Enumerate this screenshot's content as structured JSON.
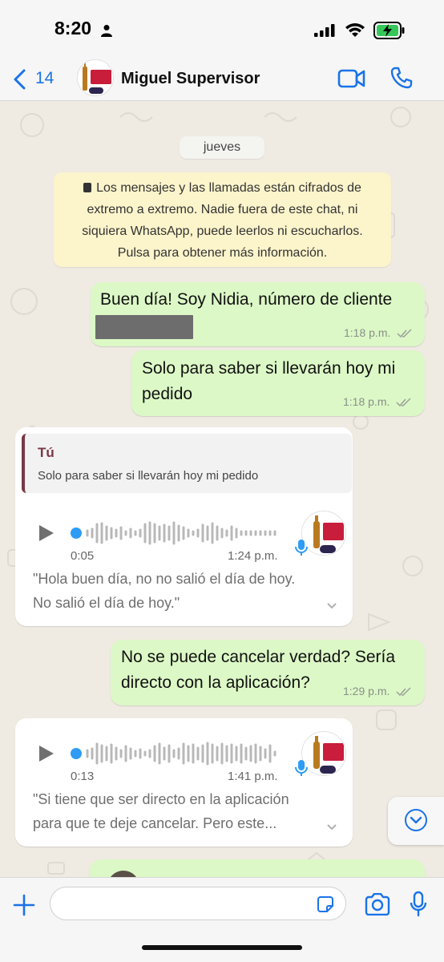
{
  "status_bar": {
    "time": "8:20",
    "icons": [
      "person-icon",
      "signal-icon",
      "wifi-icon",
      "battery-charging-icon"
    ]
  },
  "header": {
    "back_count": "14",
    "contact_name": "Miguel Supervisor",
    "icons": [
      "back-chevron-icon",
      "video-call-icon",
      "phone-icon"
    ],
    "accent_color": "#1a73e8"
  },
  "chat": {
    "date_label": "jueves",
    "encryption_notice": "Los mensajes y las llamadas están cifrados de extremo a extremo. Nadie fuera de este chat, ni siquiera WhatsApp, puede leerlos ni escucharlos. Pulsa para obtener más información.",
    "encryption_lines": [
      "Los mensajes y las llamadas están cifrados de",
      "extremo a extremo. Nadie fuera de este chat, ni",
      "siquiera WhatsApp, puede leerlos ni escucharlos.",
      "Pulsa para obtener más información."
    ],
    "messages": [
      {
        "direction": "outgoing",
        "text": "Buen día! Soy Nidia, número de cliente",
        "redacted": true,
        "time": "1:18 p.m.",
        "read_ticks": true
      },
      {
        "direction": "outgoing",
        "lines": [
          "Solo para saber si llevarán hoy mi",
          "pedido"
        ],
        "text": "Solo para saber si llevarán hoy mi pedido",
        "time": "1:18 p.m.",
        "read_ticks": true
      },
      {
        "direction": "incoming",
        "type": "voice",
        "quote_author": "Tú",
        "quote_text": "Solo para saber si llevarán hoy mi pedido",
        "duration": "0:05",
        "time": "1:24 p.m.",
        "transcript_lines": [
          "\"Hola buen día, no no salió el día de hoy.",
          "No salió el día de hoy.\""
        ]
      },
      {
        "direction": "outgoing",
        "lines": [
          "No se puede cancelar verdad? Sería",
          "directo con la aplicación?"
        ],
        "text": "No se puede cancelar verdad? Sería directo con la aplicación?",
        "time": "1:29 p.m.",
        "read_ticks": true
      },
      {
        "direction": "incoming",
        "type": "voice",
        "duration": "0:13",
        "time": "1:41 p.m.",
        "transcript_lines": [
          "\"Si tiene que ser directo en la aplicación",
          "para que te deje cancelar. Pero este..."
        ]
      }
    ]
  },
  "composer": {
    "input_value": "",
    "icons": [
      "plus-icon",
      "sticker-icon",
      "camera-icon",
      "microphone-icon"
    ]
  },
  "colors": {
    "outgoing_bubble": "#dcf8c6",
    "incoming_bubble": "#ffffff",
    "notice_bg": "#fcf4cb",
    "quote_author": "#7a3645",
    "voice_dot": "#2e9cf5"
  }
}
